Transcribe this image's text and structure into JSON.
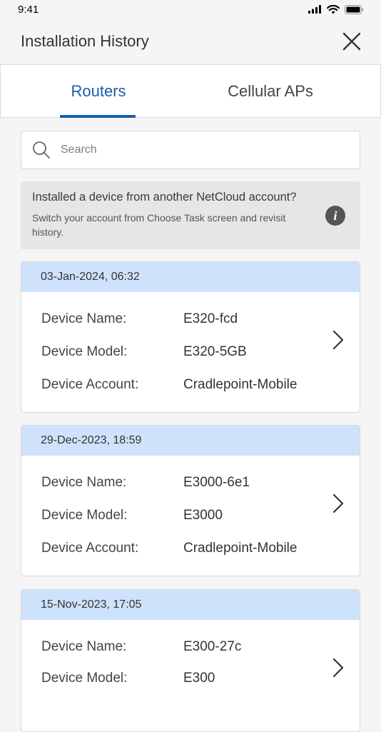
{
  "status_bar": {
    "time": "9:41"
  },
  "header": {
    "title": "Installation History"
  },
  "tabs": [
    {
      "label": "Routers",
      "active": true
    },
    {
      "label": "Cellular APs",
      "active": false
    }
  ],
  "search": {
    "placeholder": "Search",
    "value": ""
  },
  "info": {
    "title": "Installed a device from another NetCloud account?",
    "body": "Switch your account from Choose Task screen and revisit history."
  },
  "labels": {
    "device_name": "Device Name:",
    "device_model": "Device Model:",
    "device_account": "Device Account:"
  },
  "records": [
    {
      "date": "03-Jan-2024, 06:32",
      "device_name": "E320-fcd",
      "device_model": "E320-5GB",
      "device_account": "Cradlepoint-Mobile"
    },
    {
      "date": "29-Dec-2023, 18:59",
      "device_name": "E3000-6e1",
      "device_model": "E3000",
      "device_account": "Cradlepoint-Mobile"
    },
    {
      "date": "15-Nov-2023, 17:05",
      "device_name": "E300-27c",
      "device_model": "E300",
      "device_account": ""
    }
  ],
  "colors": {
    "accent": "#1a5ea8",
    "date_band": "#cfe2fb",
    "info_bg": "#e6e6e6"
  }
}
